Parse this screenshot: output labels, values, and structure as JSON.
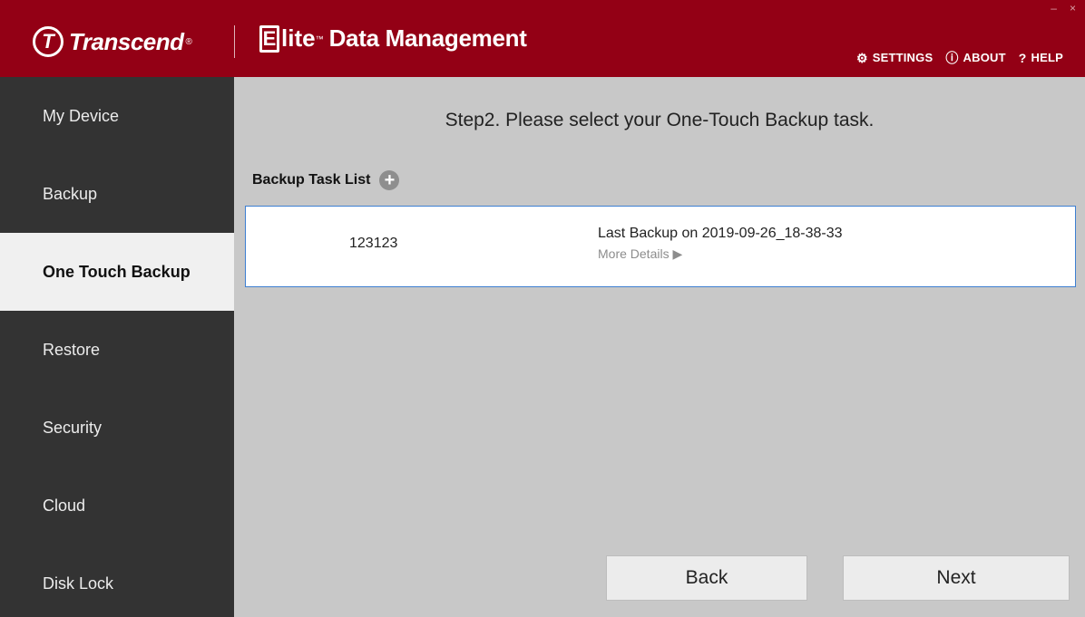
{
  "app": {
    "brand": "Transcend",
    "brand_mark": "T",
    "brand_reg": "®",
    "product_e": "E",
    "product_lite": "lite",
    "product_tm": "™",
    "product_rest": "Data Management",
    "window_controls": {
      "minimize": "–",
      "close": "×"
    }
  },
  "topnav": {
    "settings": {
      "icon": "gear-icon",
      "glyph": "⚙",
      "label": "SETTINGS"
    },
    "about": {
      "icon": "info-icon",
      "glyph": "ⓘ",
      "label": "ABOUT"
    },
    "help": {
      "icon": "help-icon",
      "glyph": "?",
      "label": "HELP"
    }
  },
  "sidebar": {
    "items": [
      {
        "label": "My Device",
        "active": false
      },
      {
        "label": "Backup",
        "active": false
      },
      {
        "label": "One Touch Backup",
        "active": true
      },
      {
        "label": "Restore",
        "active": false
      },
      {
        "label": "Security",
        "active": false
      },
      {
        "label": "Cloud",
        "active": false
      },
      {
        "label": "Disk Lock",
        "active": false
      }
    ]
  },
  "main": {
    "step_title": "Step2. Please select your One-Touch Backup task.",
    "tasklist_label": "Backup Task List",
    "add_glyph": "+",
    "tasks": [
      {
        "name": "123123",
        "last_backup": "Last Backup on 2019-09-26_18-38-33",
        "more": "More Details ▶"
      }
    ],
    "back_label": "Back",
    "next_label": "Next"
  },
  "colors": {
    "titlebar": "#930015",
    "sidebar": "#333333",
    "content_bg": "#c8c8c8",
    "selection_border": "#3d7fd1"
  }
}
